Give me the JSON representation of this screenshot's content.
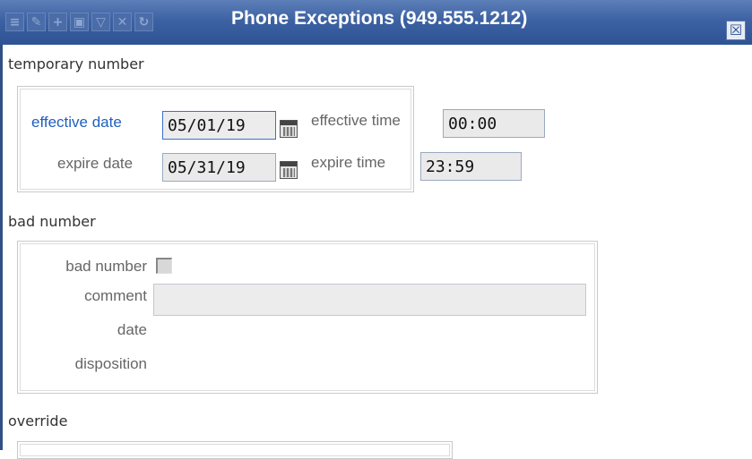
{
  "window": {
    "title": "Phone Exceptions (949.555.1212)",
    "close_icon": "☒",
    "toolbar_icons": [
      {
        "name": "list-icon",
        "glyph": "≡"
      },
      {
        "name": "edit-icon",
        "glyph": "✎"
      },
      {
        "name": "add-icon",
        "glyph": "+"
      },
      {
        "name": "save-icon",
        "glyph": "▣"
      },
      {
        "name": "delete-icon",
        "glyph": "▽"
      },
      {
        "name": "cancel-icon",
        "glyph": "✕"
      },
      {
        "name": "refresh-icon",
        "glyph": "↻"
      }
    ]
  },
  "temporary_number": {
    "section_label": "temporary number",
    "effective_date_label": "effective date",
    "effective_date_value": "05/01/19",
    "effective_time_label": "effective time",
    "effective_time_value": "00:00",
    "expire_date_label": "expire date",
    "expire_date_value": "05/31/19",
    "expire_time_label": "expire time",
    "expire_time_value": "23:59"
  },
  "bad_number": {
    "section_label": "bad number",
    "bad_number_label": "bad number",
    "bad_number_checked": false,
    "comment_label": "comment",
    "comment_value": "",
    "date_label": "date",
    "disposition_label": "disposition"
  },
  "override": {
    "section_label": "override"
  }
}
